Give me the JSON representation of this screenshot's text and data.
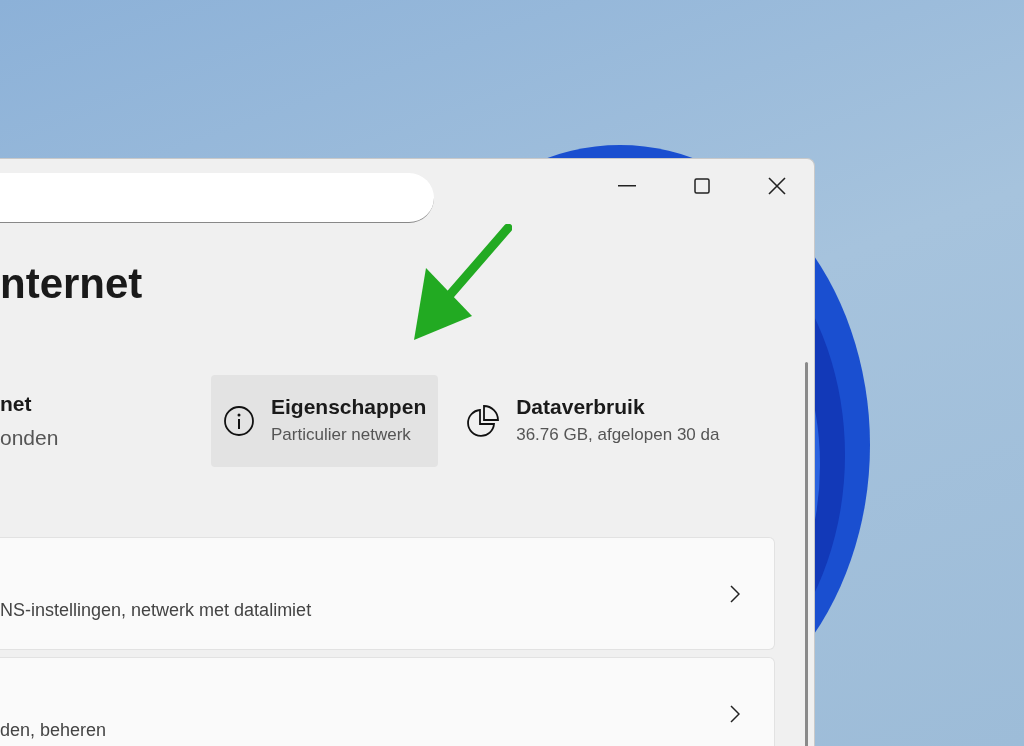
{
  "page_title": "nternet",
  "network": {
    "name": "net",
    "status": "onden"
  },
  "properties": [
    {
      "kind": "info",
      "title": "Eigenschappen",
      "subtitle": "Particulier netwerk",
      "selected": true
    },
    {
      "kind": "data",
      "title": "Dataverbruik",
      "subtitle": "36.76 GB, afgelopen 30 da",
      "selected": false
    }
  ],
  "settings_rows": [
    {
      "subtitle": "NS-instellingen, netwerk met datalimiet"
    },
    {
      "subtitle": "den, beheren"
    }
  ]
}
